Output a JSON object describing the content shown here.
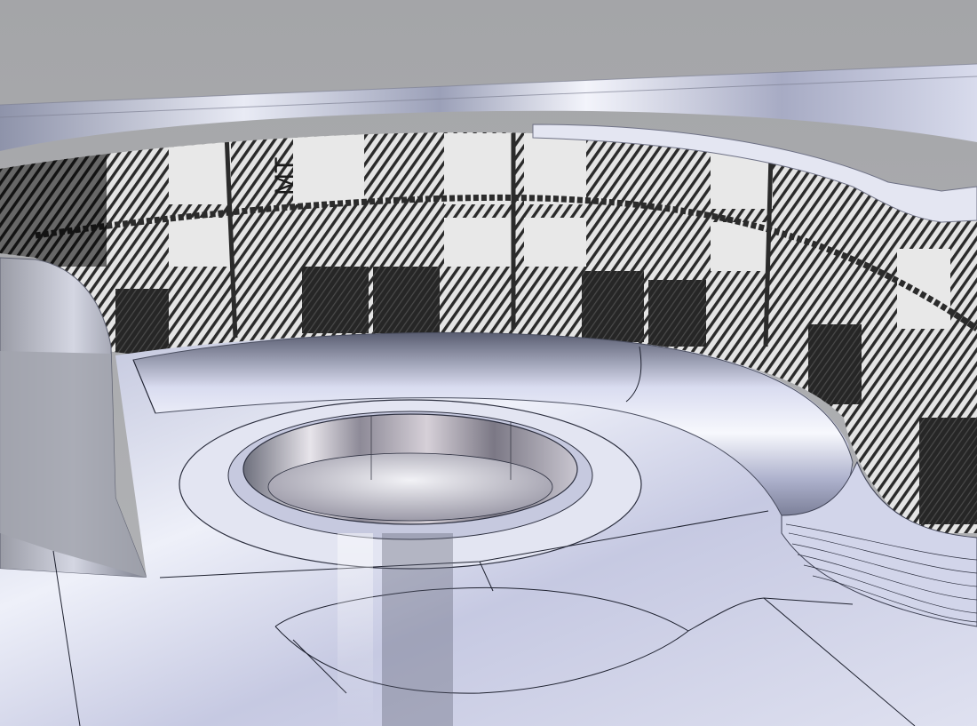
{
  "viewport": {
    "texture_label": "MT",
    "colors": {
      "background": "#a9aaad",
      "chrome_light": "#eef0f8",
      "chrome_mid": "#b8bcd2",
      "chrome_dark": "#5c6070",
      "chrome_tint": "#c9cde6",
      "tartan_light": "#e6e6e6",
      "tartan_dark": "#1a1a1a"
    }
  }
}
